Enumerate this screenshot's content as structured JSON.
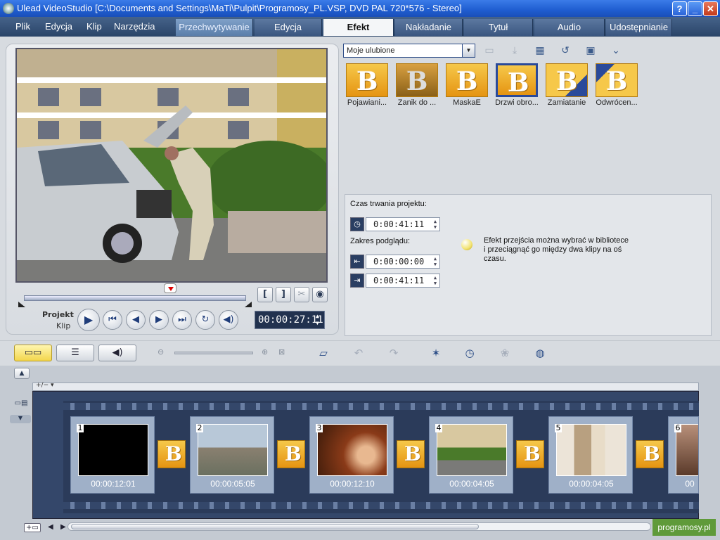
{
  "window": {
    "title": "Ulead VideoStudio [C:\\Documents and Settings\\MaTi\\Pulpit\\Programosy_PL.VSP, DVD PAL 720*576 - Stereo]",
    "buttons": {
      "help": "?",
      "minimize": "_",
      "close": "✕"
    }
  },
  "menu": [
    "Plik",
    "Edycja",
    "Klip",
    "Narzędzia"
  ],
  "steps": [
    "Przechwytywanie",
    "Edycja",
    "Efekt",
    "Nakładanie",
    "Tytuł",
    "Audio",
    "Udostępnianie"
  ],
  "preview": {
    "label_project": "Projekt",
    "label_clip": "Klip",
    "timecode": "00:00:27:11"
  },
  "library": {
    "selected": "Moje ulubione",
    "effects": [
      {
        "label": "Pojawiani..."
      },
      {
        "label": "Zanik do ..."
      },
      {
        "label": "MaskaE"
      },
      {
        "label": "Drzwi obro..."
      },
      {
        "label": "Zamiatanie"
      },
      {
        "label": "Odwrócen..."
      }
    ]
  },
  "info": {
    "duration_label": "Czas trwania projektu:",
    "duration": "0:00:41:11",
    "range_label": "Zakres podglądu:",
    "range_start": "0:00:00:00",
    "range_end": "0:00:41:11",
    "hint": "Efekt przejścia można wybrać w bibliotece i przeciągnąć go między dwa klipy na oś czasu."
  },
  "timeline": {
    "clips": [
      {
        "num": "1",
        "duration": "00:00:12:01",
        "color": "#000000"
      },
      {
        "num": "2",
        "duration": "00:00:05:05",
        "color": "#8aa0b4"
      },
      {
        "num": "3",
        "duration": "00:00:12:10",
        "color": "#7a3a1a"
      },
      {
        "num": "4",
        "duration": "00:00:04:05",
        "color": "#8aa870"
      },
      {
        "num": "5",
        "duration": "00:00:04:05",
        "color": "#c8b8a0"
      },
      {
        "num": "6",
        "duration": "00",
        "color": "#5a3a2a"
      }
    ]
  },
  "watermark": "programosy.pl",
  "icons": {
    "play": "play-icon",
    "home": "home-icon",
    "prev_frame": "prev-frame-icon",
    "next_frame": "next-frame-icon",
    "end": "end-icon",
    "repeat": "repeat-icon",
    "volume": "volume-icon"
  }
}
